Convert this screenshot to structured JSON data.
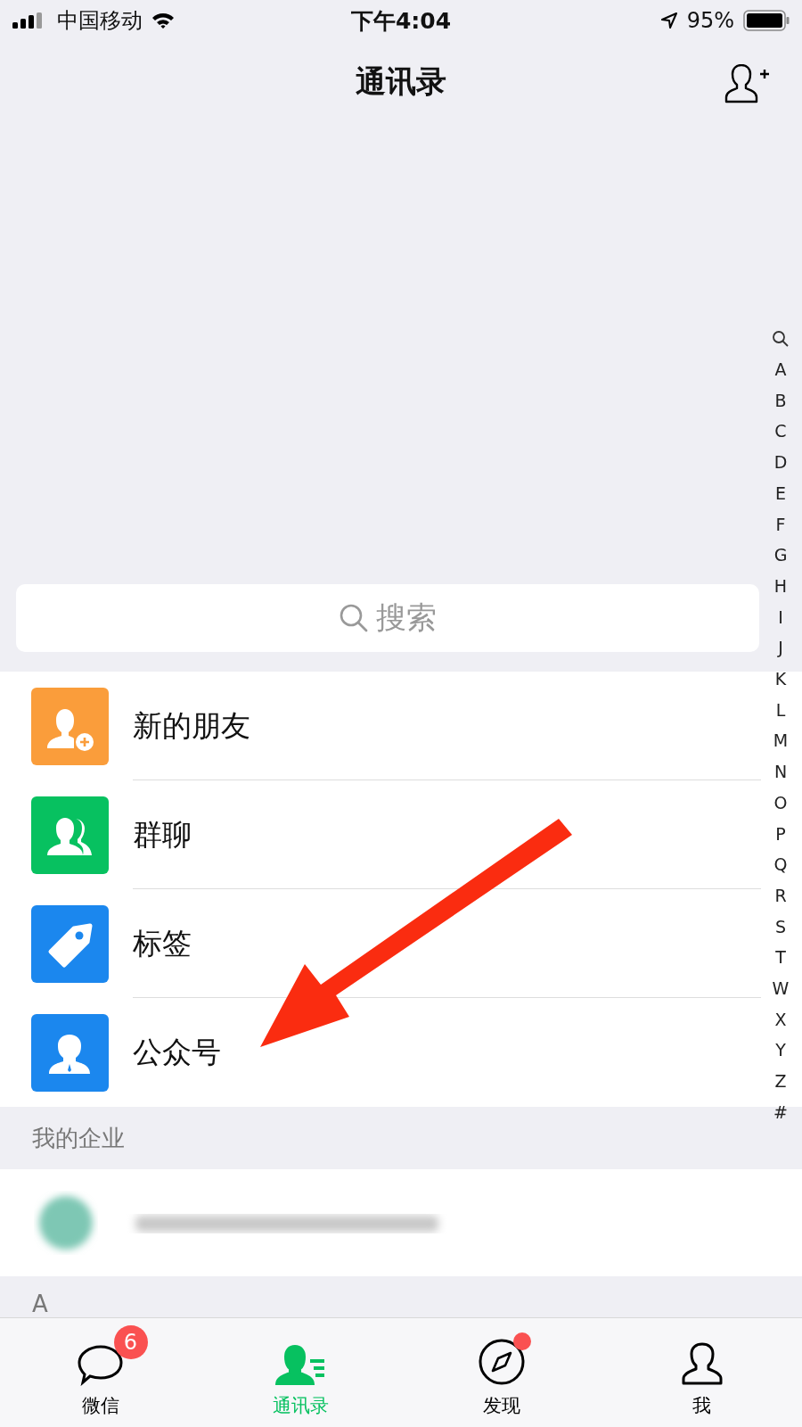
{
  "status_bar": {
    "carrier": "中国移动",
    "time": "下午4:04",
    "battery": "95%"
  },
  "nav": {
    "title": "通讯录"
  },
  "search": {
    "placeholder": "搜索"
  },
  "menu_items": [
    {
      "label": "新的朋友",
      "kind": "new-friend",
      "color": "#fa9d3b"
    },
    {
      "label": "群聊",
      "kind": "group",
      "color": "#07c160"
    },
    {
      "label": "标签",
      "kind": "tag",
      "color": "#1b87ee"
    },
    {
      "label": "公众号",
      "kind": "official",
      "color": "#1b87ee"
    }
  ],
  "sections": [
    {
      "title": "我的企业"
    },
    {
      "title": "A"
    }
  ],
  "index_letters": [
    "A",
    "B",
    "C",
    "D",
    "E",
    "F",
    "G",
    "H",
    "I",
    "J",
    "K",
    "L",
    "M",
    "N",
    "O",
    "P",
    "Q",
    "R",
    "S",
    "T",
    "W",
    "X",
    "Y",
    "Z",
    "#"
  ],
  "tabs": [
    {
      "label": "微信",
      "kind": "chat",
      "selected": false,
      "badge": "6",
      "dot": false
    },
    {
      "label": "通讯录",
      "kind": "contacts",
      "selected": true,
      "dot": false
    },
    {
      "label": "发现",
      "kind": "discover",
      "selected": false,
      "dot": true
    },
    {
      "label": "我",
      "kind": "me",
      "selected": false,
      "dot": false
    }
  ]
}
